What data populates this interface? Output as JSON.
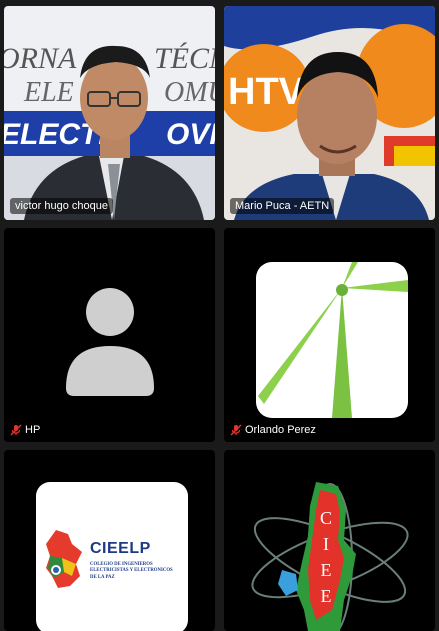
{
  "participants": [
    {
      "name": "victor hugo choque",
      "muted": false,
      "active": false,
      "backdrop": [
        "ORNA",
        "TÉCN",
        "ELE",
        "OMU",
        "ELECTI",
        "OVIL"
      ]
    },
    {
      "name": "Mario Puca - AETN",
      "muted": false,
      "active": true,
      "logo_text": "HTV"
    },
    {
      "name": "HP",
      "muted": true,
      "active": false
    },
    {
      "name": "Orlando Perez",
      "muted": true,
      "active": false
    },
    {
      "name": "",
      "muted": false,
      "active": false,
      "logo": {
        "acronym": "CIEELP",
        "line1": "COLEGIO DE INGENIEROS",
        "line2": "ELECTRICISTAS Y ELECTRONICOS",
        "line3": "DE LA PAZ"
      }
    },
    {
      "name": "",
      "muted": false,
      "active": false,
      "logo": {
        "letters": [
          "C",
          "I",
          "E",
          "E"
        ]
      }
    }
  ],
  "colors": {
    "active_border": "#27c24c",
    "mic_off": "#e5352b",
    "tile_bg": "#242424"
  }
}
